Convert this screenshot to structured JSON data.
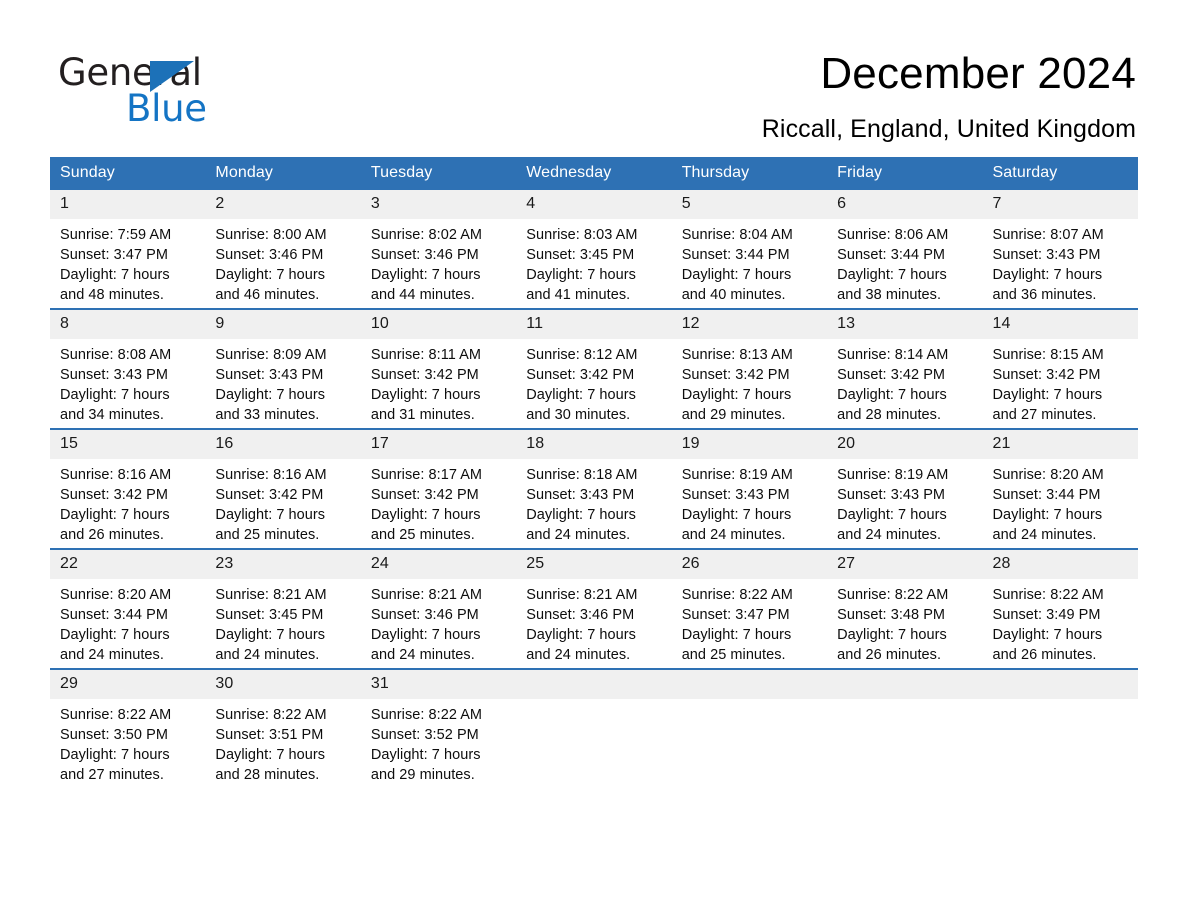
{
  "logo": {
    "word_one": "General",
    "word_two": "Blue",
    "triangle_color": "#1c71b8",
    "blue_text_color": "#1474c4"
  },
  "header": {
    "month_title": "December 2024",
    "location": "Riccall, England, United Kingdom"
  },
  "theme": {
    "header_blue": "#2e71b4",
    "daynum_band": "#f0f0f0",
    "cell_background": "#ffffff",
    "text_color": "#000000"
  },
  "columns": [
    "Sunday",
    "Monday",
    "Tuesday",
    "Wednesday",
    "Thursday",
    "Friday",
    "Saturday"
  ],
  "weeks": [
    [
      {
        "day": "1",
        "sunrise": "Sunrise: 7:59 AM",
        "sunset": "Sunset: 3:47 PM",
        "daylight_line1": "Daylight: 7 hours",
        "daylight_line2": "and 48 minutes."
      },
      {
        "day": "2",
        "sunrise": "Sunrise: 8:00 AM",
        "sunset": "Sunset: 3:46 PM",
        "daylight_line1": "Daylight: 7 hours",
        "daylight_line2": "and 46 minutes."
      },
      {
        "day": "3",
        "sunrise": "Sunrise: 8:02 AM",
        "sunset": "Sunset: 3:46 PM",
        "daylight_line1": "Daylight: 7 hours",
        "daylight_line2": "and 44 minutes."
      },
      {
        "day": "4",
        "sunrise": "Sunrise: 8:03 AM",
        "sunset": "Sunset: 3:45 PM",
        "daylight_line1": "Daylight: 7 hours",
        "daylight_line2": "and 41 minutes."
      },
      {
        "day": "5",
        "sunrise": "Sunrise: 8:04 AM",
        "sunset": "Sunset: 3:44 PM",
        "daylight_line1": "Daylight: 7 hours",
        "daylight_line2": "and 40 minutes."
      },
      {
        "day": "6",
        "sunrise": "Sunrise: 8:06 AM",
        "sunset": "Sunset: 3:44 PM",
        "daylight_line1": "Daylight: 7 hours",
        "daylight_line2": "and 38 minutes."
      },
      {
        "day": "7",
        "sunrise": "Sunrise: 8:07 AM",
        "sunset": "Sunset: 3:43 PM",
        "daylight_line1": "Daylight: 7 hours",
        "daylight_line2": "and 36 minutes."
      }
    ],
    [
      {
        "day": "8",
        "sunrise": "Sunrise: 8:08 AM",
        "sunset": "Sunset: 3:43 PM",
        "daylight_line1": "Daylight: 7 hours",
        "daylight_line2": "and 34 minutes."
      },
      {
        "day": "9",
        "sunrise": "Sunrise: 8:09 AM",
        "sunset": "Sunset: 3:43 PM",
        "daylight_line1": "Daylight: 7 hours",
        "daylight_line2": "and 33 minutes."
      },
      {
        "day": "10",
        "sunrise": "Sunrise: 8:11 AM",
        "sunset": "Sunset: 3:42 PM",
        "daylight_line1": "Daylight: 7 hours",
        "daylight_line2": "and 31 minutes."
      },
      {
        "day": "11",
        "sunrise": "Sunrise: 8:12 AM",
        "sunset": "Sunset: 3:42 PM",
        "daylight_line1": "Daylight: 7 hours",
        "daylight_line2": "and 30 minutes."
      },
      {
        "day": "12",
        "sunrise": "Sunrise: 8:13 AM",
        "sunset": "Sunset: 3:42 PM",
        "daylight_line1": "Daylight: 7 hours",
        "daylight_line2": "and 29 minutes."
      },
      {
        "day": "13",
        "sunrise": "Sunrise: 8:14 AM",
        "sunset": "Sunset: 3:42 PM",
        "daylight_line1": "Daylight: 7 hours",
        "daylight_line2": "and 28 minutes."
      },
      {
        "day": "14",
        "sunrise": "Sunrise: 8:15 AM",
        "sunset": "Sunset: 3:42 PM",
        "daylight_line1": "Daylight: 7 hours",
        "daylight_line2": "and 27 minutes."
      }
    ],
    [
      {
        "day": "15",
        "sunrise": "Sunrise: 8:16 AM",
        "sunset": "Sunset: 3:42 PM",
        "daylight_line1": "Daylight: 7 hours",
        "daylight_line2": "and 26 minutes."
      },
      {
        "day": "16",
        "sunrise": "Sunrise: 8:16 AM",
        "sunset": "Sunset: 3:42 PM",
        "daylight_line1": "Daylight: 7 hours",
        "daylight_line2": "and 25 minutes."
      },
      {
        "day": "17",
        "sunrise": "Sunrise: 8:17 AM",
        "sunset": "Sunset: 3:42 PM",
        "daylight_line1": "Daylight: 7 hours",
        "daylight_line2": "and 25 minutes."
      },
      {
        "day": "18",
        "sunrise": "Sunrise: 8:18 AM",
        "sunset": "Sunset: 3:43 PM",
        "daylight_line1": "Daylight: 7 hours",
        "daylight_line2": "and 24 minutes."
      },
      {
        "day": "19",
        "sunrise": "Sunrise: 8:19 AM",
        "sunset": "Sunset: 3:43 PM",
        "daylight_line1": "Daylight: 7 hours",
        "daylight_line2": "and 24 minutes."
      },
      {
        "day": "20",
        "sunrise": "Sunrise: 8:19 AM",
        "sunset": "Sunset: 3:43 PM",
        "daylight_line1": "Daylight: 7 hours",
        "daylight_line2": "and 24 minutes."
      },
      {
        "day": "21",
        "sunrise": "Sunrise: 8:20 AM",
        "sunset": "Sunset: 3:44 PM",
        "daylight_line1": "Daylight: 7 hours",
        "daylight_line2": "and 24 minutes."
      }
    ],
    [
      {
        "day": "22",
        "sunrise": "Sunrise: 8:20 AM",
        "sunset": "Sunset: 3:44 PM",
        "daylight_line1": "Daylight: 7 hours",
        "daylight_line2": "and 24 minutes."
      },
      {
        "day": "23",
        "sunrise": "Sunrise: 8:21 AM",
        "sunset": "Sunset: 3:45 PM",
        "daylight_line1": "Daylight: 7 hours",
        "daylight_line2": "and 24 minutes."
      },
      {
        "day": "24",
        "sunrise": "Sunrise: 8:21 AM",
        "sunset": "Sunset: 3:46 PM",
        "daylight_line1": "Daylight: 7 hours",
        "daylight_line2": "and 24 minutes."
      },
      {
        "day": "25",
        "sunrise": "Sunrise: 8:21 AM",
        "sunset": "Sunset: 3:46 PM",
        "daylight_line1": "Daylight: 7 hours",
        "daylight_line2": "and 24 minutes."
      },
      {
        "day": "26",
        "sunrise": "Sunrise: 8:22 AM",
        "sunset": "Sunset: 3:47 PM",
        "daylight_line1": "Daylight: 7 hours",
        "daylight_line2": "and 25 minutes."
      },
      {
        "day": "27",
        "sunrise": "Sunrise: 8:22 AM",
        "sunset": "Sunset: 3:48 PM",
        "daylight_line1": "Daylight: 7 hours",
        "daylight_line2": "and 26 minutes."
      },
      {
        "day": "28",
        "sunrise": "Sunrise: 8:22 AM",
        "sunset": "Sunset: 3:49 PM",
        "daylight_line1": "Daylight: 7 hours",
        "daylight_line2": "and 26 minutes."
      }
    ],
    [
      {
        "day": "29",
        "sunrise": "Sunrise: 8:22 AM",
        "sunset": "Sunset: 3:50 PM",
        "daylight_line1": "Daylight: 7 hours",
        "daylight_line2": "and 27 minutes."
      },
      {
        "day": "30",
        "sunrise": "Sunrise: 8:22 AM",
        "sunset": "Sunset: 3:51 PM",
        "daylight_line1": "Daylight: 7 hours",
        "daylight_line2": "and 28 minutes."
      },
      {
        "day": "31",
        "sunrise": "Sunrise: 8:22 AM",
        "sunset": "Sunset: 3:52 PM",
        "daylight_line1": "Daylight: 7 hours",
        "daylight_line2": "and 29 minutes."
      },
      {
        "day": "",
        "sunrise": "",
        "sunset": "",
        "daylight_line1": "",
        "daylight_line2": ""
      },
      {
        "day": "",
        "sunrise": "",
        "sunset": "",
        "daylight_line1": "",
        "daylight_line2": ""
      },
      {
        "day": "",
        "sunrise": "",
        "sunset": "",
        "daylight_line1": "",
        "daylight_line2": ""
      },
      {
        "day": "",
        "sunrise": "",
        "sunset": "",
        "daylight_line1": "",
        "daylight_line2": ""
      }
    ]
  ]
}
